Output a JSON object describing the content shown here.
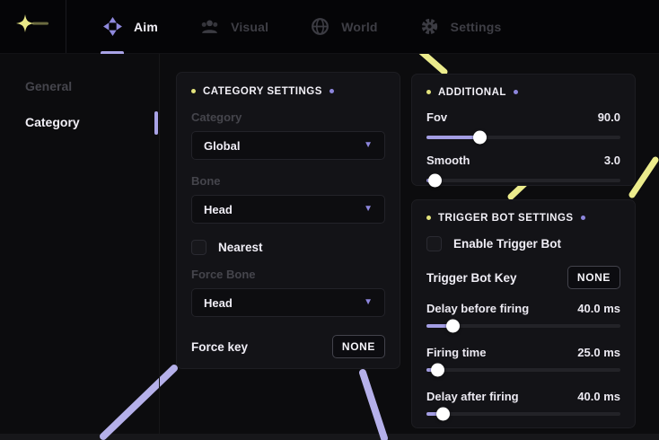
{
  "colors": {
    "accent_purple": "#a9a3e6",
    "accent_yellow": "#ecec8c",
    "panel_bg": "#131317",
    "page_bg": "#0c0c0e"
  },
  "topbar": {
    "tabs": [
      {
        "label": "Aim",
        "icon": "crosshair",
        "active": true
      },
      {
        "label": "Visual",
        "icon": "people",
        "active": false
      },
      {
        "label": "World",
        "icon": "globe",
        "active": false
      },
      {
        "label": "Settings",
        "icon": "gear",
        "active": false
      }
    ]
  },
  "sidebar": {
    "items": [
      {
        "label": "General",
        "active": false
      },
      {
        "label": "Category",
        "active": true
      }
    ]
  },
  "category_panel": {
    "title": "CATEGORY SETTINGS",
    "category_label": "Category",
    "category_value": "Global",
    "bone_label": "Bone",
    "bone_value": "Head",
    "nearest_label": "Nearest",
    "nearest_checked": false,
    "force_bone_label": "Force Bone",
    "force_bone_value": "Head",
    "force_key_label": "Force key",
    "force_key_value": "NONE"
  },
  "additional_panel": {
    "title": "ADDITIONAL",
    "sliders": [
      {
        "label": "Fov",
        "value": "90.0",
        "fill_pct": 28
      },
      {
        "label": "Smooth",
        "value": "3.0",
        "fill_pct": 4.5
      }
    ]
  },
  "trigger_panel": {
    "title": "TRIGGER BOT SETTINGS",
    "enable_label": "Enable Trigger Bot",
    "enable_checked": false,
    "key_label": "Trigger Bot Key",
    "key_value": "NONE",
    "sliders": [
      {
        "label": "Delay before firing",
        "value": "40.0 ms",
        "fill_pct": 14
      },
      {
        "label": "Firing time",
        "value": "25.0 ms",
        "fill_pct": 6
      },
      {
        "label": "Delay after firing",
        "value": "40.0 ms",
        "fill_pct": 9
      }
    ]
  }
}
